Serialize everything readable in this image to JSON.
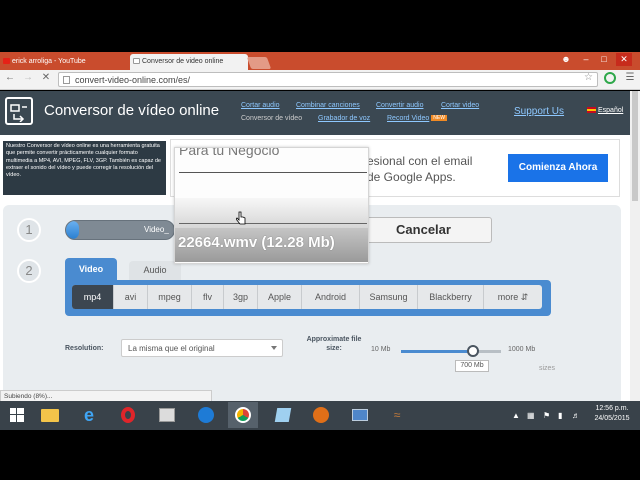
{
  "browser": {
    "tabs": [
      {
        "label": "erick arroliga - YouTube",
        "active": false
      },
      {
        "label": "Conversor de video online",
        "active": true
      }
    ],
    "address": "convert-video-online.com/es/",
    "user_icon": "person-icon"
  },
  "header": {
    "title": "Conversor de vídeo online",
    "nav": [
      {
        "label": "Cortar audio"
      },
      {
        "label": "Combinar canciones"
      },
      {
        "label": "Convertir audio"
      },
      {
        "label": "Cortar video"
      },
      {
        "label": "Conversor de vídeo"
      },
      {
        "label": "Grabador de voz"
      },
      {
        "label": "Record Video",
        "badge": "NEW"
      }
    ],
    "support": "Support Us",
    "language": "Español"
  },
  "description": "Nuestro Conversor de vídeo online es una herramienta gratuita que permite convertir prácticamente cualquier formato multimedia a MP4, AVI, MPEG, FLV, 3GP. También es capaz de extraer el sonido del vídeo y puede corregir la resolución del vídeo.",
  "ad": {
    "partial_title": "Para tu Negocio",
    "line1": "esional con el email",
    "line2": "de Google Apps.",
    "cta": "Comienza Ahora"
  },
  "step1": {
    "number": "1",
    "progress_label": "Video_",
    "progress_fraction": 0.08,
    "cancel": "Cancelar"
  },
  "step2": {
    "number": "2",
    "tabs": {
      "video": "Video",
      "audio": "Audio"
    },
    "formats": [
      "mp4",
      "avi",
      "mpeg",
      "flv",
      "3gp",
      "Apple",
      "Android",
      "Samsung",
      "Blackberry",
      "more"
    ],
    "selected_format": "mp4",
    "resolution_label": "Resolution:",
    "resolution_value": "La misma que el original",
    "size_label": "Approximate file size:",
    "size_min": "10 Mb",
    "size_max": "1000 Mb",
    "size_value": "700 Mb",
    "size_fraction": 0.7,
    "sizes_hint": "sizes"
  },
  "overlay": {
    "ghost": "Para tu Negocio",
    "filename": "22664.wmv (12.28 Mb)"
  },
  "status_bubble": "Subiendo (8%)...",
  "taskbar": {
    "time": "12:56 p.m.",
    "date": "24/05/2015"
  },
  "colors": {
    "header_bg": "#3b4852",
    "accent_blue": "#4a8bd0",
    "cta_blue": "#1a73e8",
    "chrome_frame": "#c94c2d",
    "taskbar": "#39424a"
  }
}
